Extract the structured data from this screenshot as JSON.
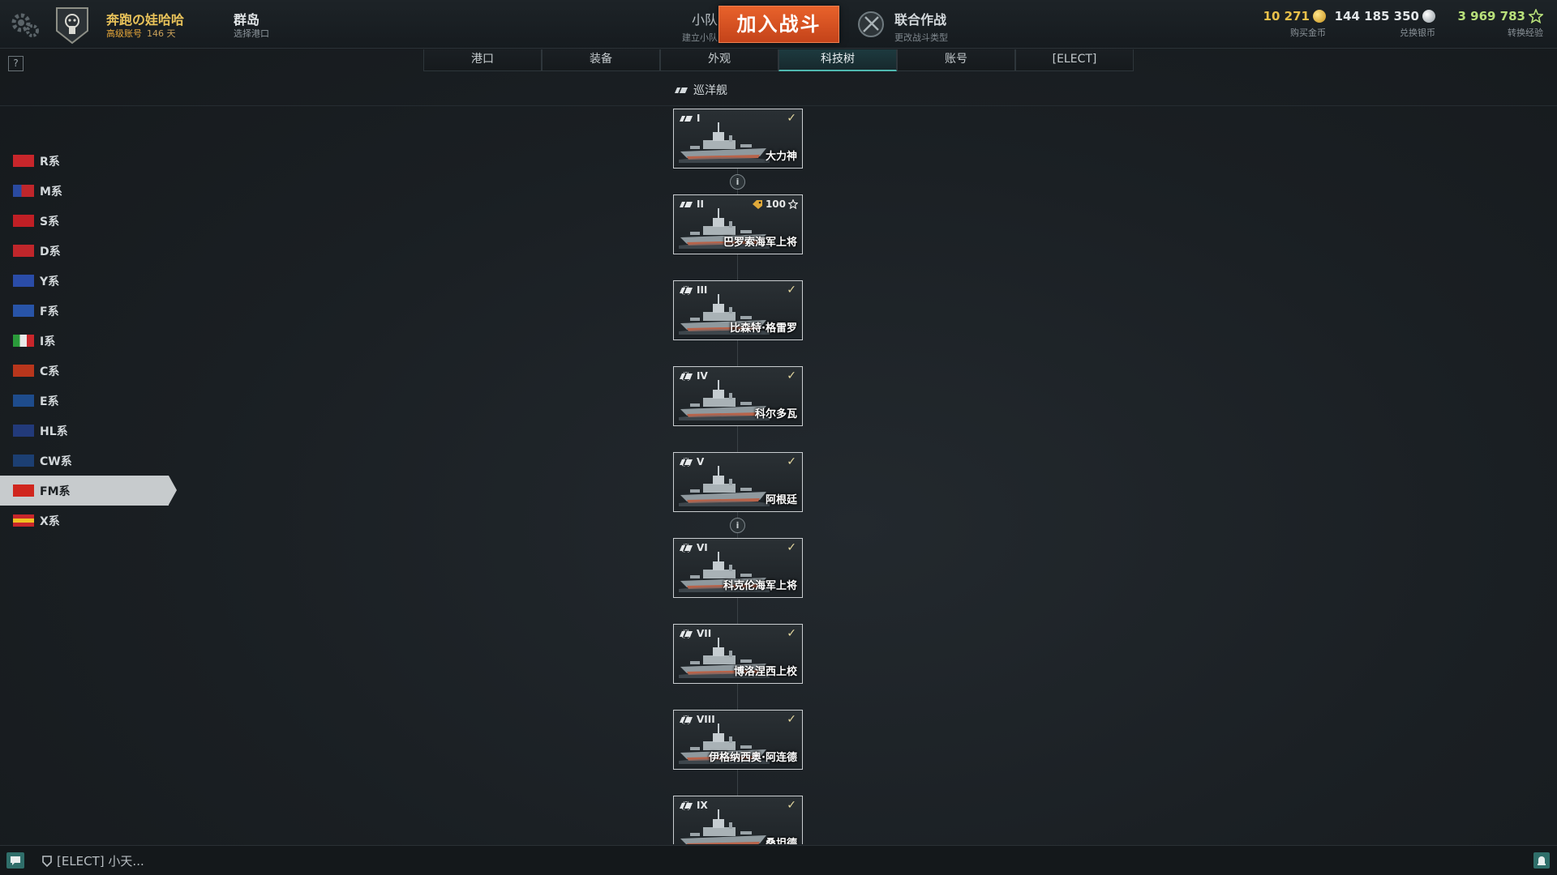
{
  "topbar": {
    "player_name": "奔跑の娃哈哈",
    "account_status": "高级账号",
    "premium_days": "146 天",
    "port_name": "群岛",
    "port_sub": "选择港口",
    "division_label": "小队",
    "division_sub": "建立小队",
    "battle_button": "加入战斗",
    "mode_label": "联合作战",
    "mode_sub": "更改战斗类型",
    "gold_value": "10 271",
    "gold_label": "购买金币",
    "silver_value": "144 185 350",
    "silver_label": "兑换银币",
    "xp_value": "3 969 783",
    "xp_label": "转换经验"
  },
  "help_label": "?",
  "tabs": [
    {
      "label": "港口"
    },
    {
      "label": "装备"
    },
    {
      "label": "外观"
    },
    {
      "label": "科技树",
      "active": true
    },
    {
      "label": "账号"
    },
    {
      "label": "[ELECT]"
    }
  ],
  "category": "巡洋舰",
  "nations": [
    {
      "label": "R系",
      "flag": "flag-r"
    },
    {
      "label": "M系",
      "flag": "flag-m"
    },
    {
      "label": "S系",
      "flag": "flag-s"
    },
    {
      "label": "D系",
      "flag": "flag-d"
    },
    {
      "label": "Y系",
      "flag": "flag-y"
    },
    {
      "label": "F系",
      "flag": "flag-f"
    },
    {
      "label": "I系",
      "flag": "flag-i"
    },
    {
      "label": "C系",
      "flag": "flag-c"
    },
    {
      "label": "E系",
      "flag": "flag-e"
    },
    {
      "label": "HL系",
      "flag": "flag-hl"
    },
    {
      "label": "CW系",
      "flag": "flag-cw"
    },
    {
      "label": "FM系",
      "flag": "flag-fm",
      "active": true
    },
    {
      "label": "X系",
      "flag": "flag-x"
    }
  ],
  "info_glyph": "i",
  "ships": [
    {
      "tier": "I",
      "name": "大力神",
      "researched": true,
      "elite": false
    },
    {
      "tier": "II",
      "name": "巴罗索海军上将",
      "researched": false,
      "cost": "100",
      "elite": false
    },
    {
      "tier": "III",
      "name": "比森特·格雷罗",
      "researched": true,
      "elite": true
    },
    {
      "tier": "IV",
      "name": "科尔多瓦",
      "researched": true,
      "elite": true
    },
    {
      "tier": "V",
      "name": "阿根廷",
      "researched": true,
      "elite": true
    },
    {
      "tier": "VI",
      "name": "科克伦海军上将",
      "researched": true,
      "elite": true
    },
    {
      "tier": "VII",
      "name": "博洛涅西上校",
      "researched": true,
      "elite": true
    },
    {
      "tier": "VIII",
      "name": "伊格纳西奥·阿连德",
      "researched": true,
      "elite": true
    },
    {
      "tier": "IX",
      "name": "桑坦德",
      "researched": true,
      "elite": true
    }
  ],
  "check_glyph": "✓",
  "bottombar": {
    "clan_text": "[ELECT] 小天..."
  },
  "colors": {
    "battle_button": "#d85424",
    "gold": "#e8c04a",
    "xp": "#b8e07a",
    "active_tab_accent": "#4fb8b0",
    "active_nation": "#c7cbcd"
  }
}
